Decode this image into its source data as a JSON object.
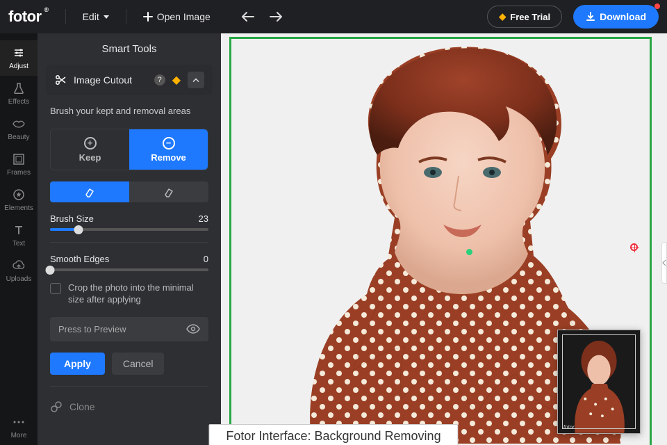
{
  "header": {
    "logo": "fotor",
    "edit_label": "Edit",
    "open_image": "Open Image",
    "free_trial": "Free Trial",
    "download": "Download"
  },
  "rail": {
    "items": [
      {
        "label": "Adjust"
      },
      {
        "label": "Effects"
      },
      {
        "label": "Beauty"
      },
      {
        "label": "Frames"
      },
      {
        "label": "Elements"
      },
      {
        "label": "Text"
      },
      {
        "label": "Uploads"
      }
    ],
    "more": "More"
  },
  "panel": {
    "title": "Smart Tools",
    "section": "Image Cutout",
    "hint": "Brush your kept and removal areas",
    "keep": "Keep",
    "remove": "Remove",
    "brush_size_label": "Brush Size",
    "brush_size_value": "23",
    "smooth_label": "Smooth Edges",
    "smooth_value": "0",
    "crop_hint": "Crop the photo into the minimal size after applying",
    "preview": "Press to Preview",
    "apply": "Apply",
    "cancel": "Cancel",
    "clone": "Clone"
  },
  "caption": "Fotor Interface: Background Removing"
}
